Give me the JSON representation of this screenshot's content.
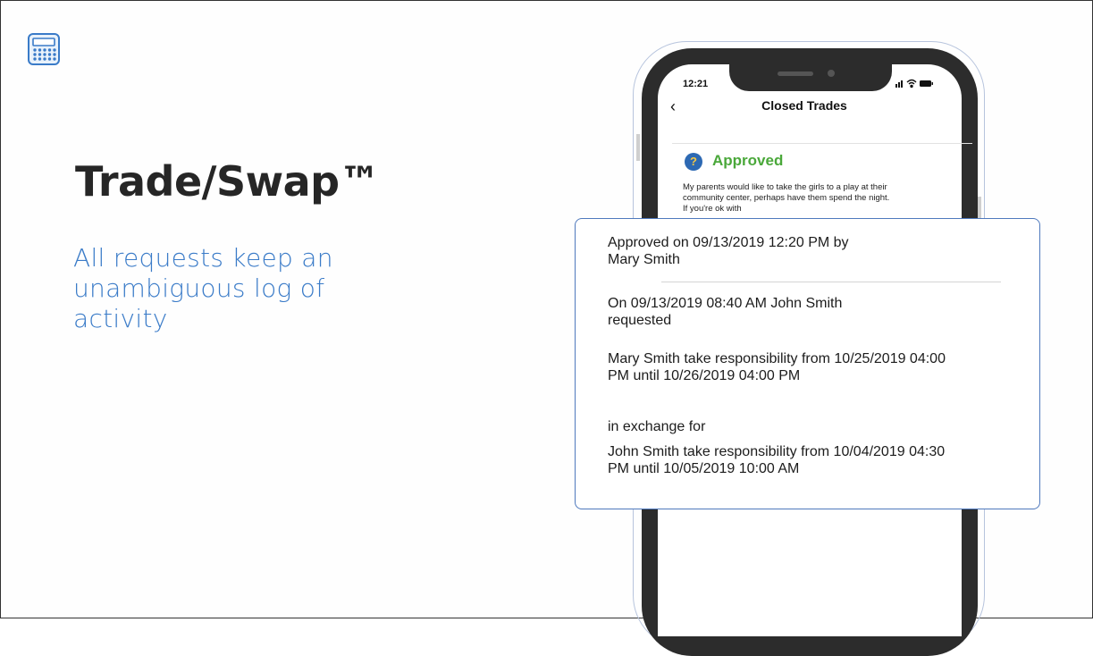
{
  "slide": {
    "title": "Trade/Swap™",
    "subtitle": "All requests keep an unambiguous log of activity",
    "app_icon": "calculator-icon",
    "accent_color": "#3a7bc8"
  },
  "phone": {
    "status_time": "12:21",
    "status_icons": [
      "signal-icon",
      "wifi-icon",
      "battery-icon"
    ],
    "nav_title": "Closed Trades",
    "back_icon": "chevron-left-icon",
    "status": {
      "icon": "question-icon",
      "label": "Approved",
      "color": "#4aa83a"
    },
    "message": "My parents would like to take the girls to a play at their community center, perhaps have them spend the night. If you're ok with"
  },
  "log_card": {
    "approved_line": "Approved on 09/13/2019 12:20 PM by Mary Smith",
    "requested_line": "On 09/13/2019 08:40 AM John Smith requested",
    "responsibility_1": "Mary Smith take responsibility from 10/25/2019 04:00 PM until 10/26/2019 04:00 PM",
    "exchange_text": "in exchange for",
    "responsibility_2": "John Smith take responsibility from 10/04/2019 04:30 PM until 10/05/2019 10:00 AM"
  }
}
